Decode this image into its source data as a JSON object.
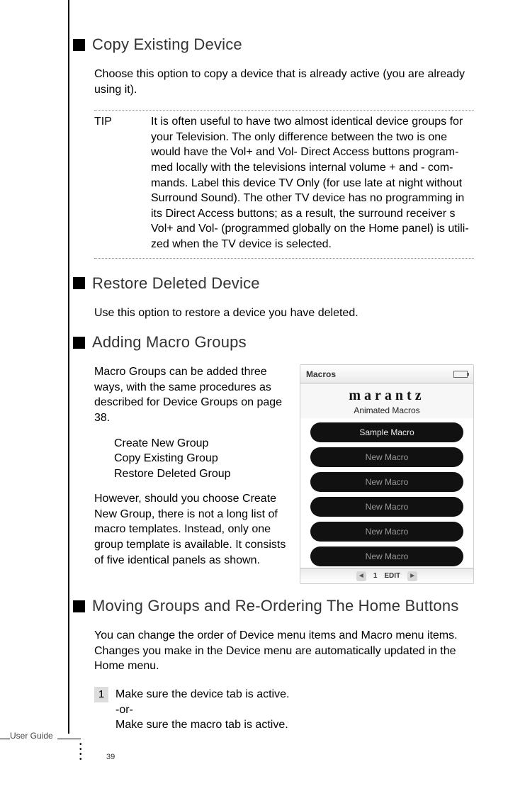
{
  "sections": {
    "copy": {
      "title": "Copy Existing Device",
      "body": "Choose this option to copy a device that is already active (you are already using it)."
    },
    "tip": {
      "label": "TIP",
      "text": "It is often useful to have two almost identical device groups for your Television. The only difference between the two is one would have the Vol+ and Vol- Direct Access buttons program-med locally with the televisions internal volume + and - com-mands. Label this device TV Only (for use late at night without Surround Sound). The other TV device has no programming in its Direct Access buttons; as a result, the surround receiver s Vol+ and Vol- (programmed globally on the Home panel) is utili-zed when the TV device is selected."
    },
    "restore": {
      "title": "Restore Deleted Device",
      "body": "Use this option to restore a device you have deleted."
    },
    "macro": {
      "title": "Adding Macro Groups",
      "p1": "Macro Groups can be added three ways, with the same procedures as described for Device Groups on page 38.",
      "list": [
        "Create New Group",
        "Copy Existing Group",
        "Restore Deleted Group"
      ],
      "p2": "However, should you choose  Create New Group,  there is not a long list of macro templates. Instead, only one group template is available. It consists of five identical panels as shown."
    },
    "moving": {
      "title": "Moving Groups and  Re-Ordering The Home Buttons",
      "body": "You can change the order of Device menu items and Macro menu items. Changes you make in the Device menu are automatically updated in the Home menu.",
      "step1_num": "1",
      "step1_a": "Make sure the device tab is active.",
      "step1_or": "-or-",
      "step1_b": "Make sure the macro tab is active."
    }
  },
  "figure": {
    "top_label": "Macros",
    "brand": "marantz",
    "subtitle": "Animated Macros",
    "buttons": [
      "Sample Macro",
      "New Macro",
      "New Macro",
      "New Macro",
      "New Macro",
      "New Macro"
    ],
    "bottom_page": "1",
    "bottom_edit": "EDIT"
  },
  "footer": {
    "label": "User Guide",
    "page": "39"
  }
}
